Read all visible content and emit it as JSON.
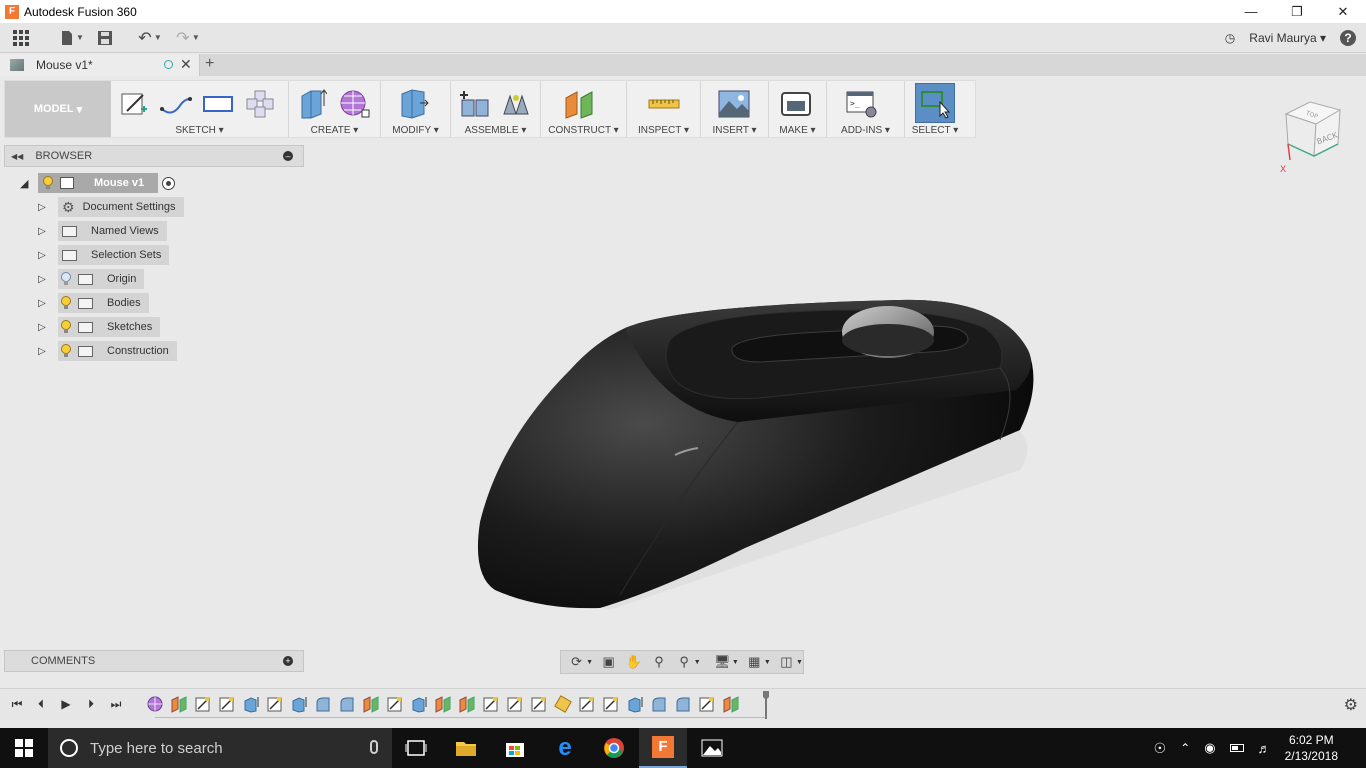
{
  "titlebar": {
    "title": "Autodesk Fusion 360"
  },
  "qat": {
    "user": "Ravi Maurya"
  },
  "tab": {
    "name": "Mouse v1*"
  },
  "toolbar": {
    "workspace": "MODEL",
    "groups": [
      "SKETCH",
      "CREATE",
      "MODIFY",
      "ASSEMBLE",
      "CONSTRUCT",
      "INSPECT",
      "INSERT",
      "MAKE",
      "ADD-INS",
      "SELECT"
    ]
  },
  "browser": {
    "label": "BROWSER",
    "root": "Mouse v1",
    "items": [
      "Document Settings",
      "Named Views",
      "Selection Sets",
      "Origin",
      "Bodies",
      "Sketches",
      "Construction"
    ]
  },
  "viewcube": {
    "face": "BACK",
    "top": "TOP",
    "axis": "X"
  },
  "comments": {
    "label": "COMMENTS"
  },
  "taskbar": {
    "search_placeholder": "Type here to search",
    "time": "6:02 PM",
    "date": "2/13/2018"
  },
  "colors": {
    "select_active": "#5b8ec5",
    "body": "#1b1b1b",
    "accent": "#f37735"
  }
}
